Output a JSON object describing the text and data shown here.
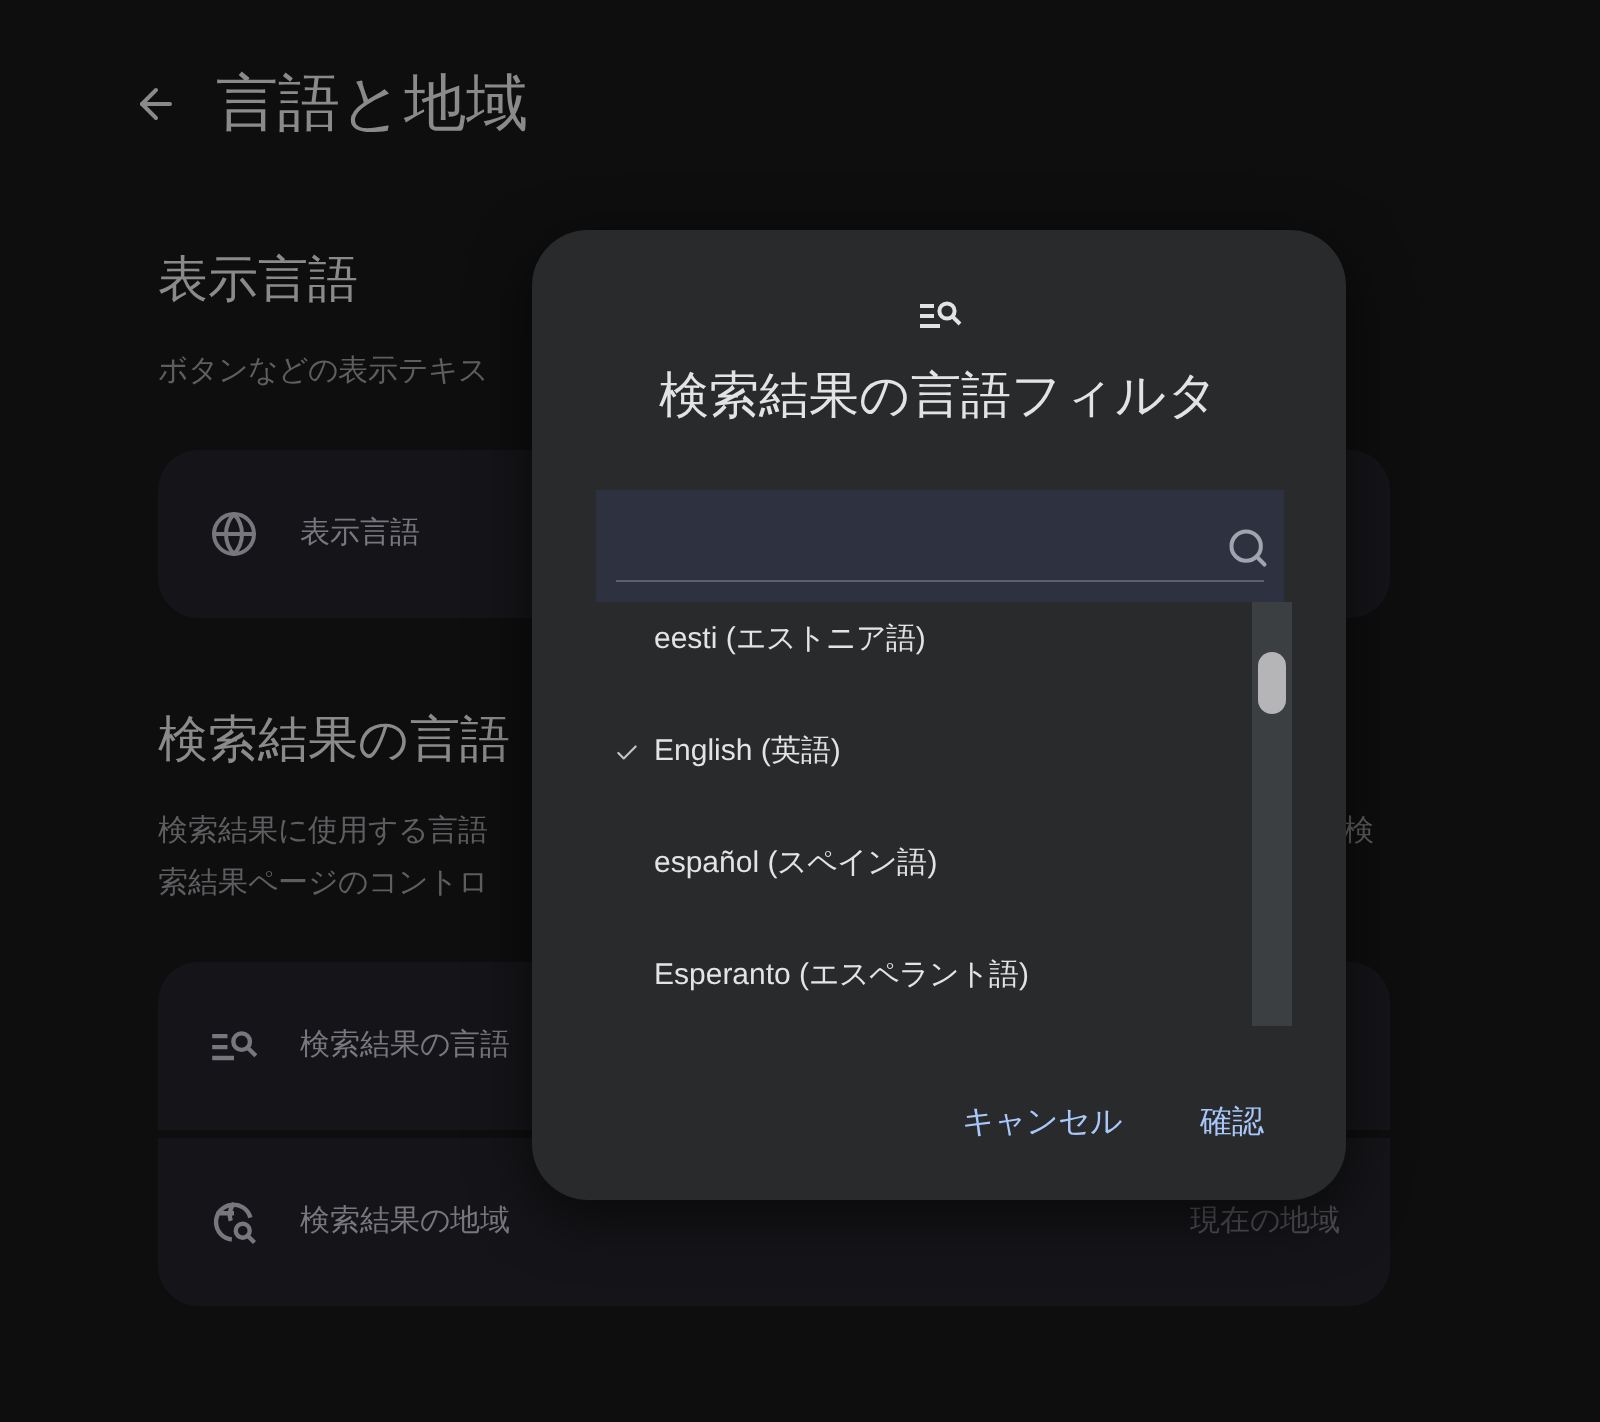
{
  "header": {
    "title": "言語と地域"
  },
  "sections": [
    {
      "heading": "表示言語",
      "description": [
        {
          "left": "ボタンなどの表示テキス"
        }
      ],
      "rows": [
        {
          "label": "表示言語"
        }
      ]
    },
    {
      "heading": "検索結果の言語",
      "description": [
        {
          "left": "検索結果に使用する言語",
          "right": "検"
        },
        {
          "left": "索結果ページのコントロ"
        }
      ],
      "rows": [
        {
          "label": "検索結果の言語"
        },
        {
          "label": "検索結果の地域",
          "value": "現在の地域"
        }
      ]
    }
  ],
  "dialog": {
    "title": "検索結果の言語フィルタ",
    "options": [
      {
        "label": "eesti (エストニア語)",
        "checked": false
      },
      {
        "label": "English (英語)",
        "checked": true
      },
      {
        "label": "español (スペイン語)",
        "checked": false
      },
      {
        "label": "Esperanto (エスペラント語)",
        "checked": false
      }
    ],
    "buttons": [
      "キャンセル",
      "確認"
    ]
  }
}
